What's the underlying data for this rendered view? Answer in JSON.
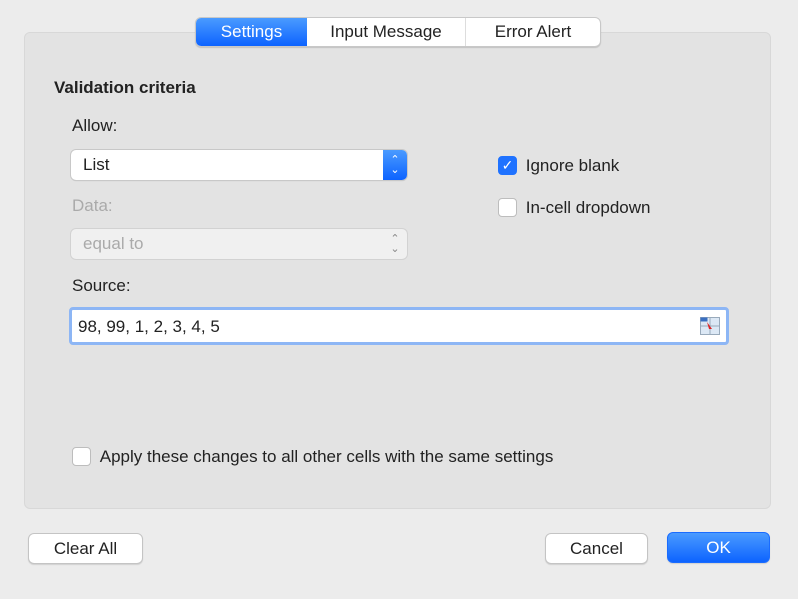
{
  "tabs": [
    {
      "label": "Settings",
      "active": true
    },
    {
      "label": "Input Message"
    },
    {
      "label": "Error Alert"
    }
  ],
  "section_title": "Validation criteria",
  "allow": {
    "label": "Allow:",
    "value": "List"
  },
  "data": {
    "label": "Data:",
    "value": "equal to",
    "disabled": true
  },
  "source": {
    "label": "Source:",
    "value": "98, 99, 1, 2, 3, 4, 5"
  },
  "ignore_blank": {
    "label": "Ignore blank",
    "checked": true
  },
  "in_cell_dropdown": {
    "label": "In-cell dropdown",
    "checked": false
  },
  "apply_all": {
    "label": "Apply these changes to all other cells with the same settings",
    "checked": false
  },
  "buttons": {
    "clear_all": "Clear All",
    "cancel": "Cancel",
    "ok": "OK"
  },
  "colors": {
    "accent": "#1f72ff"
  }
}
